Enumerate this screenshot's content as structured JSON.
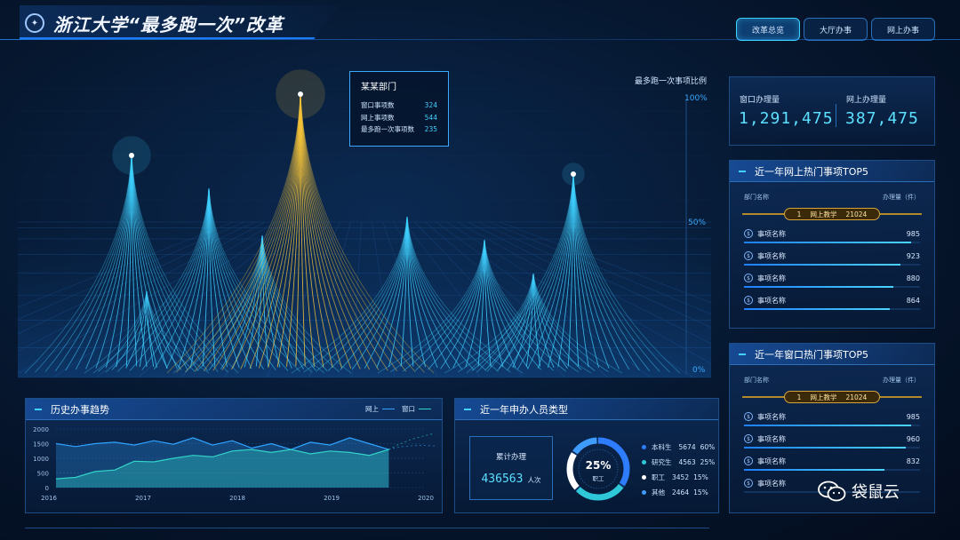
{
  "header": {
    "title": "浙江大学“最多跑一次”改革",
    "logo_icon": "university-seal-icon",
    "tabs": [
      {
        "label": "改革总览",
        "active": true
      },
      {
        "label": "大厅办事",
        "active": false
      },
      {
        "label": "网上办事",
        "active": false
      }
    ]
  },
  "main_chart": {
    "axis_title": "最多跑一次事项比例",
    "axis_ticks": [
      "100%",
      "50%",
      "0%"
    ],
    "tooltip": {
      "title": "某某部门",
      "rows": [
        {
          "label": "窗口事项数",
          "value": "324"
        },
        {
          "label": "网上事项数",
          "value": "544"
        },
        {
          "label": "最多跑一次事项数",
          "value": "235"
        }
      ]
    },
    "accent": "#3fd0ff",
    "highlight": "#f3c23a"
  },
  "stats": {
    "window_label": "窗口办理量",
    "window_value": "1,291,475",
    "online_label": "网上办理量",
    "online_value": "387,475"
  },
  "online_top5": {
    "title": "近一年网上热门事项TOP5",
    "col_dept": "部门名称",
    "col_volume": "办理量（件）",
    "first": {
      "rank": "1",
      "name": "网上教学",
      "value": "21024"
    },
    "items": [
      {
        "name": "事项名称",
        "value": "985",
        "ratio": 0.95
      },
      {
        "name": "事项名称",
        "value": "923",
        "ratio": 0.89
      },
      {
        "name": "事项名称",
        "value": "880",
        "ratio": 0.85
      },
      {
        "name": "事项名称",
        "value": "864",
        "ratio": 0.83
      }
    ]
  },
  "window_top5": {
    "title": "近一年窗口热门事项TOP5",
    "col_dept": "部门名称",
    "col_volume": "办理量（件）",
    "first": {
      "rank": "1",
      "name": "网上教学",
      "value": "21024"
    },
    "items": [
      {
        "name": "事项名称",
        "value": "985",
        "ratio": 0.95
      },
      {
        "name": "事项名称",
        "value": "960",
        "ratio": 0.92
      },
      {
        "name": "事项名称",
        "value": "832",
        "ratio": 0.8
      },
      {
        "name": "事项名称",
        "value": ""
      }
    ]
  },
  "trend": {
    "title": "历史办事趋势",
    "legend_online": "网上",
    "legend_window": "窗口",
    "chart_data": {
      "type": "area",
      "x_ticks": [
        "2016",
        "2017",
        "2018",
        "2019",
        "2020"
      ],
      "y_ticks": [
        "2000",
        "1500",
        "1000",
        "500",
        "0"
      ],
      "ylim": [
        0,
        2000
      ],
      "series": [
        {
          "name": "网上",
          "values": [
            1500,
            1400,
            1500,
            1550,
            1450,
            1600,
            1480,
            1700,
            1450,
            1600,
            1350,
            1500,
            1300,
            1550,
            1450,
            1700,
            1500,
            1300
          ]
        },
        {
          "name": "窗口",
          "values": [
            300,
            350,
            550,
            600,
            900,
            880,
            1000,
            1100,
            1050,
            1250,
            1300,
            1200,
            1300,
            1150,
            1250,
            1200,
            1100,
            1300
          ]
        }
      ],
      "colors": {
        "online": "#2fa3ff",
        "window": "#32d4c8"
      }
    }
  },
  "applicants": {
    "title": "近一年申办人员类型",
    "total_label": "累计办理",
    "total_value": "436563",
    "total_unit": "人次",
    "donut_pct": "25%",
    "donut_label": "职工",
    "chart_data": {
      "type": "pie",
      "slices": [
        {
          "name": "本科生",
          "value": 5674,
          "pct": "60%",
          "color": "#2f7dff"
        },
        {
          "name": "研究生",
          "value": 4563,
          "pct": "25%",
          "color": "#2ec8d8"
        },
        {
          "name": "职工",
          "value": 3452,
          "pct": "15%",
          "color": "#ffffff"
        },
        {
          "name": "其他",
          "value": 2464,
          "pct": "15%",
          "color": "#3f9cff"
        }
      ]
    }
  },
  "watermark": {
    "text": "袋鼠云",
    "icon": "wechat-icon"
  }
}
